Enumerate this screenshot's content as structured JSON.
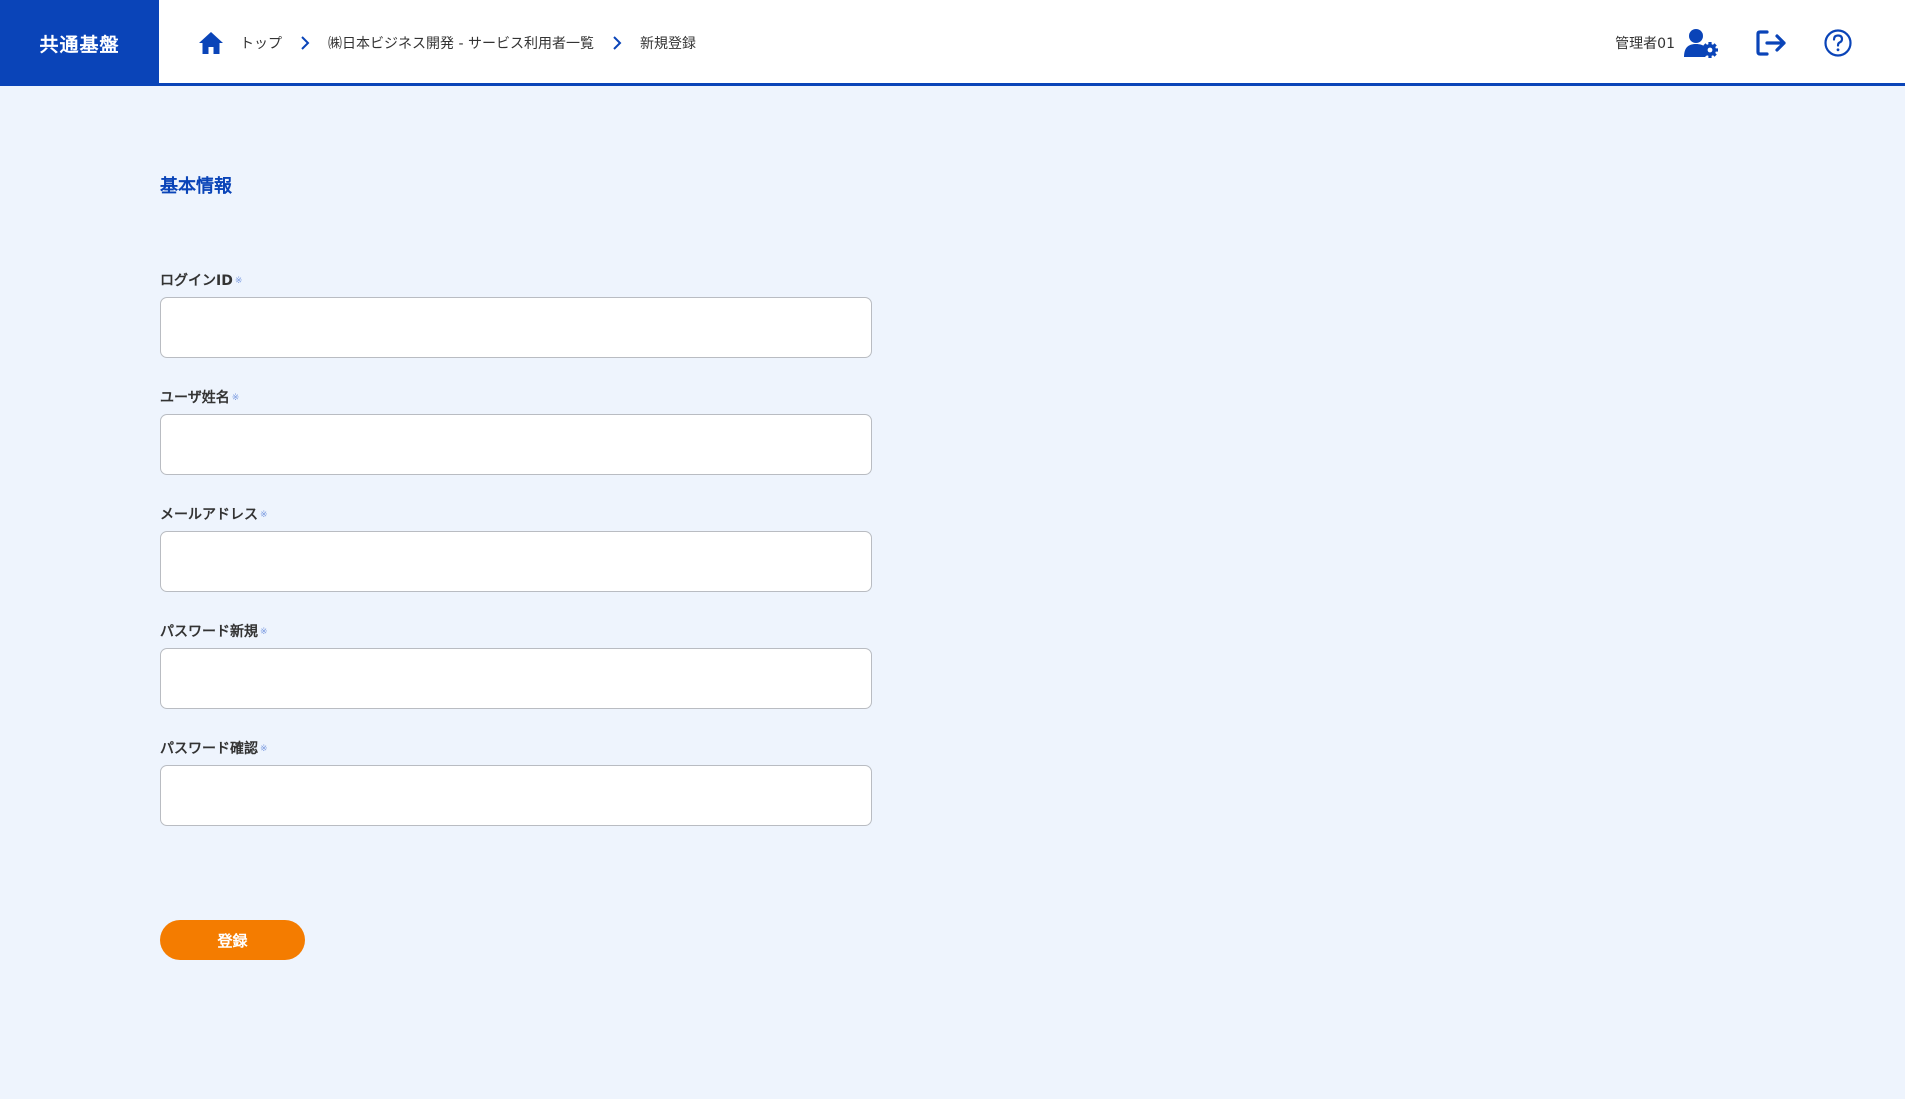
{
  "header": {
    "brand": "共通基盤",
    "breadcrumb": [
      "トップ",
      "㈱日本ビジネス開発 - サービス利用者一覧",
      "新規登録"
    ],
    "user_name": "管理者01",
    "accent_color": "#0a44b8"
  },
  "form": {
    "section_title": "基本情報",
    "required_mark": "※",
    "fields": [
      {
        "label": "ログインID",
        "value": ""
      },
      {
        "label": "ユーザ姓名",
        "value": ""
      },
      {
        "label": "メールアドレス",
        "value": ""
      },
      {
        "label": "パスワード新規",
        "value": ""
      },
      {
        "label": "パスワード確認",
        "value": ""
      }
    ],
    "submit_label": "登録",
    "submit_color": "#f47c00"
  },
  "icons": {
    "home": "home-icon",
    "separator": "chevron-right-icon",
    "user_settings": "user-gear-icon",
    "logout": "logout-icon",
    "help": "question-circle-icon"
  }
}
